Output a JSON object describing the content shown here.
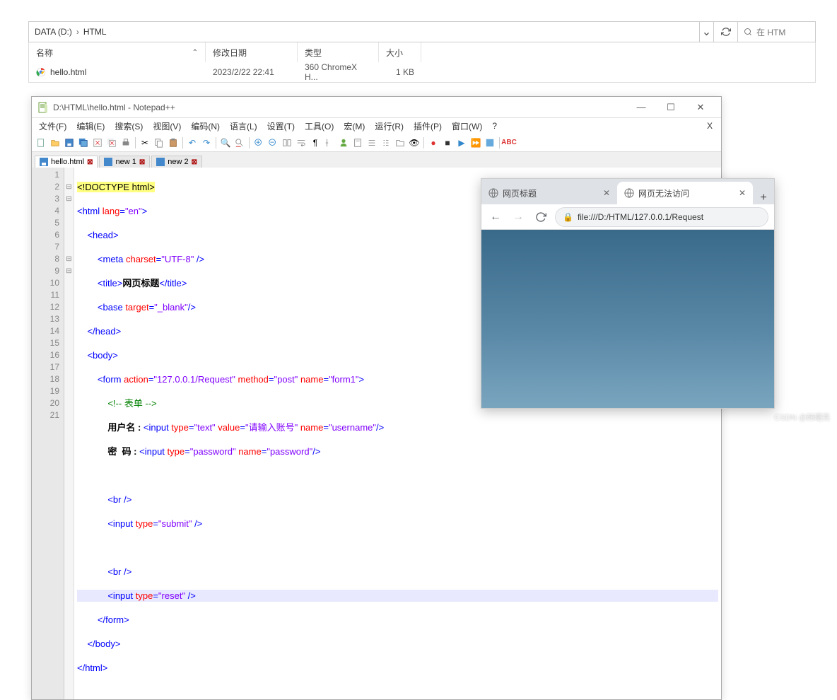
{
  "explorer": {
    "breadcrumb": {
      "part1": "DATA (D:)",
      "part2": "HTML"
    },
    "search_placeholder": "在 HTM",
    "columns": {
      "name": "名称",
      "date": "修改日期",
      "type": "类型",
      "size": "大小"
    },
    "file": {
      "name": "hello.html",
      "date": "2023/2/22 22:41",
      "type": "360 ChromeX H...",
      "size": "1 KB"
    }
  },
  "notepad": {
    "title": "D:\\HTML\\hello.html - Notepad++",
    "menus": [
      "文件(F)",
      "编辑(E)",
      "搜索(S)",
      "视图(V)",
      "编码(N)",
      "语言(L)",
      "设置(T)",
      "工具(O)",
      "宏(M)",
      "运行(R)",
      "插件(P)",
      "窗口(W)",
      "?"
    ],
    "tabs": [
      {
        "label": "hello.html",
        "active": true
      },
      {
        "label": "new 1",
        "active": false
      },
      {
        "label": "new 2",
        "active": false
      }
    ],
    "code_tokens": {
      "l1": "<!DOCTYPE html>",
      "l2": {
        "open": "<html ",
        "attr": "lang",
        "eq": "=",
        "val": "\"en\"",
        "close": ">"
      },
      "l3": "<head>",
      "l4": {
        "open": "<meta ",
        "attr": "charset",
        "val": "\"UTF-8\"",
        "close": " />"
      },
      "l5": {
        "open": "<title>",
        "txt": "网页标题",
        "close": "</title>"
      },
      "l6": {
        "open": "<base ",
        "attr": "target",
        "val": "\"_blank\"",
        "close": "/>"
      },
      "l7": "</head>",
      "l8": "<body>",
      "l9": {
        "open": "<form ",
        "a1": "action",
        "v1": "\"127.0.0.1/Request\"",
        "a2": "method",
        "v2": "\"post\"",
        "a3": "name",
        "v3": "\"form1\"",
        "close": ">"
      },
      "l10": "<!-- 表单 -->",
      "l11": {
        "txt": "用户名 : ",
        "open": "<input ",
        "a1": "type",
        "v1": "\"text\"",
        "a2": "value",
        "v2": "\"请输入账号\"",
        "a3": "name",
        "v3": "\"username\"",
        "close": "/>"
      },
      "l12": {
        "txt": "密  码 : ",
        "open": "<input ",
        "a1": "type",
        "v1": "\"password\"",
        "a2": "name",
        "v2": "\"password\"",
        "close": "/>"
      },
      "l14": "<br />",
      "l15": {
        "open": "<input ",
        "a1": "type",
        "v1": "\"submit\"",
        "close": " />"
      },
      "l17": "<br />",
      "l18": {
        "open": "<input ",
        "a1": "type",
        "v1": "\"reset\"",
        "close": " />"
      },
      "l19": "</form>",
      "l20": "</body>",
      "l21": "</html>"
    }
  },
  "browser": {
    "tab1": "网页标题",
    "tab2": "网页无法访问",
    "url": "file:///D:/HTML/127.0.0.1/Request",
    "url_icon": "🔒"
  },
  "watermark": "CSDN @韩曙亮"
}
